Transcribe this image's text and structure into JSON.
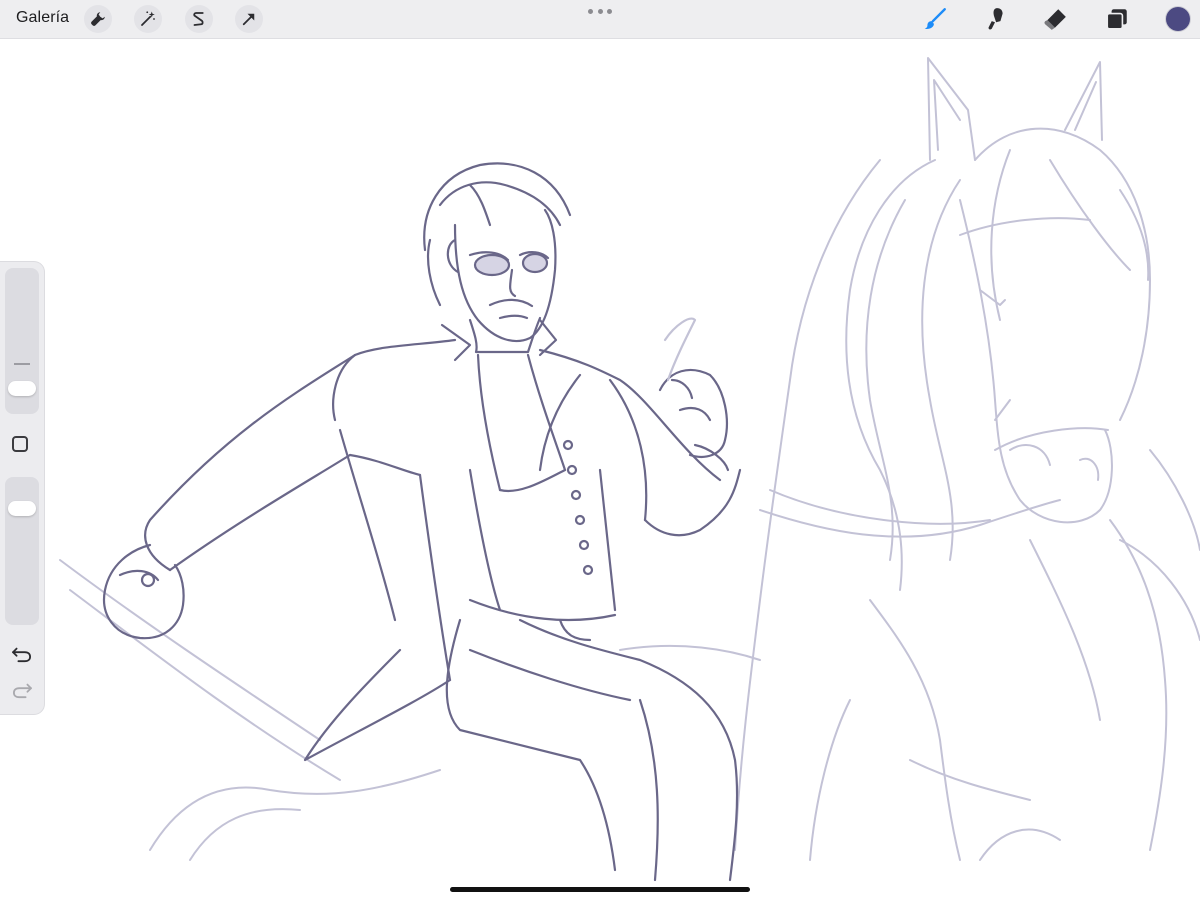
{
  "topbar": {
    "gallery_label": "Galería",
    "left_tools": [
      {
        "name": "actions",
        "icon": "wrench-icon"
      },
      {
        "name": "adjustments",
        "icon": "magic-wand-icon"
      },
      {
        "name": "selection",
        "icon": "selection-s-icon"
      },
      {
        "name": "transform",
        "icon": "arrow-cursor-icon"
      }
    ],
    "right_tools": [
      {
        "name": "brush",
        "icon": "brush-icon",
        "active": true
      },
      {
        "name": "smudge",
        "icon": "smudge-icon"
      },
      {
        "name": "eraser",
        "icon": "eraser-icon"
      },
      {
        "name": "layers",
        "icon": "layers-icon"
      }
    ],
    "active_tool_color": "#1d8cf8",
    "current_color": "#4c4a82"
  },
  "sidebar": {
    "brush_size_level": 0.15,
    "opacity_level": 0.15,
    "icons": [
      "modify-square-icon",
      "undo-icon",
      "redo-icon"
    ]
  },
  "canvas": {
    "sketch_color_dark": "#6a6789",
    "sketch_color_light": "#c3c2d6",
    "background": "#ffffff"
  }
}
